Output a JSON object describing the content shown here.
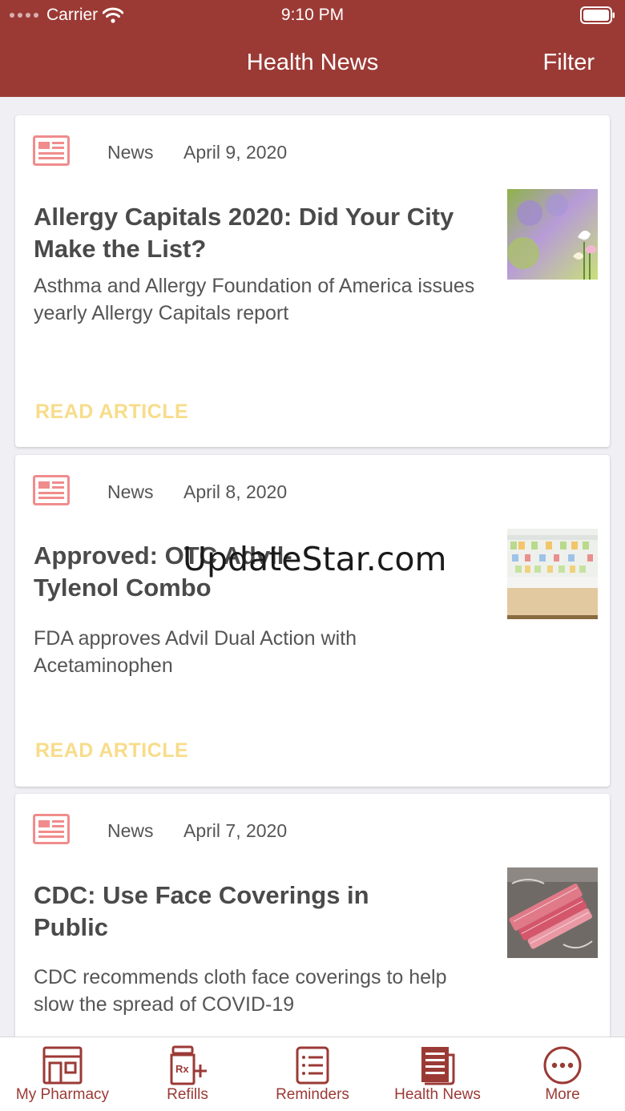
{
  "status_bar": {
    "carrier": "Carrier",
    "time": "9:10 PM"
  },
  "nav": {
    "title": "Health News",
    "filter_label": "Filter"
  },
  "articles": [
    {
      "category": "News",
      "date": "April 9, 2020",
      "headline": "Allergy Capitals 2020: Did Your City Make the List?",
      "summary": "Asthma and Allergy Foundation of America issues yearly Allergy Capitals report",
      "action": "READ ARTICLE",
      "thumbnail_icon": "flowers-photo"
    },
    {
      "category": "News",
      "date": "April 8, 2020",
      "headline": "Approved: OTC Advil-Tylenol Combo",
      "summary": "FDA approves Advil Dual Action with Acetaminophen",
      "action": "READ ARTICLE",
      "thumbnail_icon": "pharmacy-shelves-photo"
    },
    {
      "category": "News",
      "date": "April 7, 2020",
      "headline": "CDC: Use Face Coverings in Public",
      "summary": "CDC recommends cloth face coverings to help slow the spread of COVID-19",
      "action": "READ ARTICLE",
      "thumbnail_icon": "face-masks-photo"
    }
  ],
  "watermark": "UpdateStar.com",
  "tabbar": {
    "items": [
      {
        "label": "My Pharmacy",
        "icon": "storefront-icon"
      },
      {
        "label": "Refills",
        "icon": "rx-bottle-icon"
      },
      {
        "label": "Reminders",
        "icon": "checklist-icon"
      },
      {
        "label": "Health News",
        "icon": "newspaper-icon",
        "active": true
      },
      {
        "label": "More",
        "icon": "more-dots-icon"
      }
    ]
  },
  "colors": {
    "brand": "#9b3a35",
    "accent": "#f7dc8a",
    "icon_pink": "#f08c8c",
    "background": "#efeff4"
  }
}
